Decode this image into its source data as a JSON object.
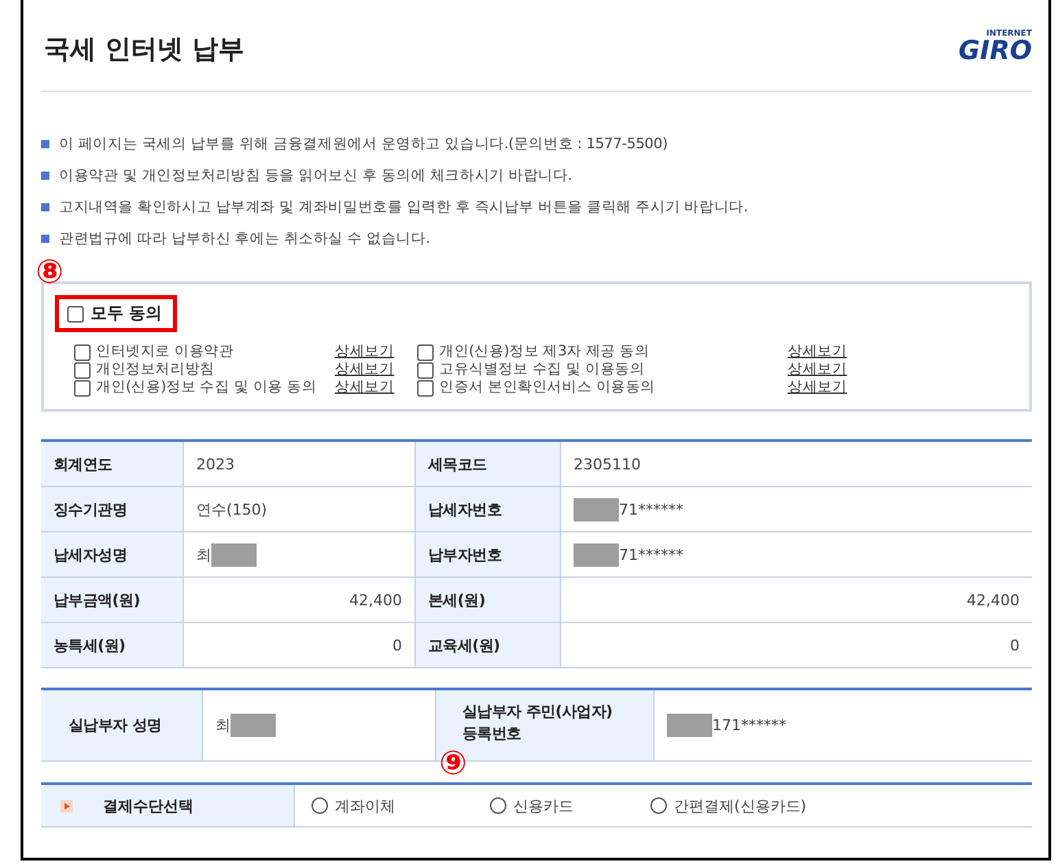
{
  "title": "국세 인터넷 납부",
  "logo": {
    "small": "INTERNET",
    "main": "GIRO"
  },
  "notices": [
    "이 페이지는 국세의 납부를 위해 금융결제원에서 운영하고 있습니다.(문의번호 : 1577-5500)",
    "이용약관 및 개인정보처리방침 등을 읽어보신 후 동의에 체크하시기 바랍니다.",
    "고지내역을 확인하시고 납부계좌 및 계좌비밀번호를 입력한 후 즉시납부 버튼을 클릭해 주시기 바랍니다.",
    "관련법규에 따라 납부하신 후에는 취소하실 수 없습니다."
  ],
  "notice_marker": "⑧",
  "agree_all": {
    "label": "모두 동의",
    "checked": false
  },
  "agreements": [
    {
      "label": "인터넷지로 이용약관",
      "link": "상세보기",
      "checked": false
    },
    {
      "label": "개인(신용)정보 제3자 제공 동의",
      "link": "상세보기",
      "checked": false
    },
    {
      "label": "개인정보처리방침",
      "link": "상세보기",
      "checked": false
    },
    {
      "label": "고유식별정보 수집 및 이용동의",
      "link": "상세보기",
      "checked": false
    },
    {
      "label": "개인(신용)정보 수집 및 이용 동의",
      "link": "상세보기",
      "checked": false
    },
    {
      "label": "인증서 본인확인서비스 이용동의",
      "link": "상세보기",
      "checked": false
    }
  ],
  "bill": [
    [
      {
        "label": "회계연도",
        "value": "2023"
      },
      {
        "label": "세목코드",
        "value": "2305110"
      }
    ],
    [
      {
        "label": "징수기관명",
        "value": "연수(150)"
      },
      {
        "label": "납세자번호",
        "value": "71******",
        "redacted": true
      }
    ],
    [
      {
        "label": "납세자성명",
        "value": "최",
        "redacted": true
      },
      {
        "label": "납부자번호",
        "value": "71******",
        "redacted": true
      }
    ],
    [
      {
        "label": "납부금액(원)",
        "value": "42,400",
        "kind": "amount"
      },
      {
        "label": "본세(원)",
        "value": "42,400",
        "kind": "amount"
      }
    ],
    [
      {
        "label": "농특세(원)",
        "value": "0",
        "kind": "amount"
      },
      {
        "label": "교육세(원)",
        "value": "0",
        "kind": "amount"
      }
    ]
  ],
  "payer": [
    {
      "label": "실납부자 성명",
      "value": "최",
      "redacted": true
    },
    {
      "label": "실납부자 주민(사업자) 등록번호",
      "value": "171******",
      "redacted": true
    }
  ],
  "payer_marker": "⑨",
  "payment": {
    "label": "결제수단선택",
    "options": [
      {
        "label": "계좌이체",
        "selected": false
      },
      {
        "label": "신용카드",
        "selected": false
      },
      {
        "label": "간편결제(신용카드)",
        "selected": false
      }
    ]
  }
}
